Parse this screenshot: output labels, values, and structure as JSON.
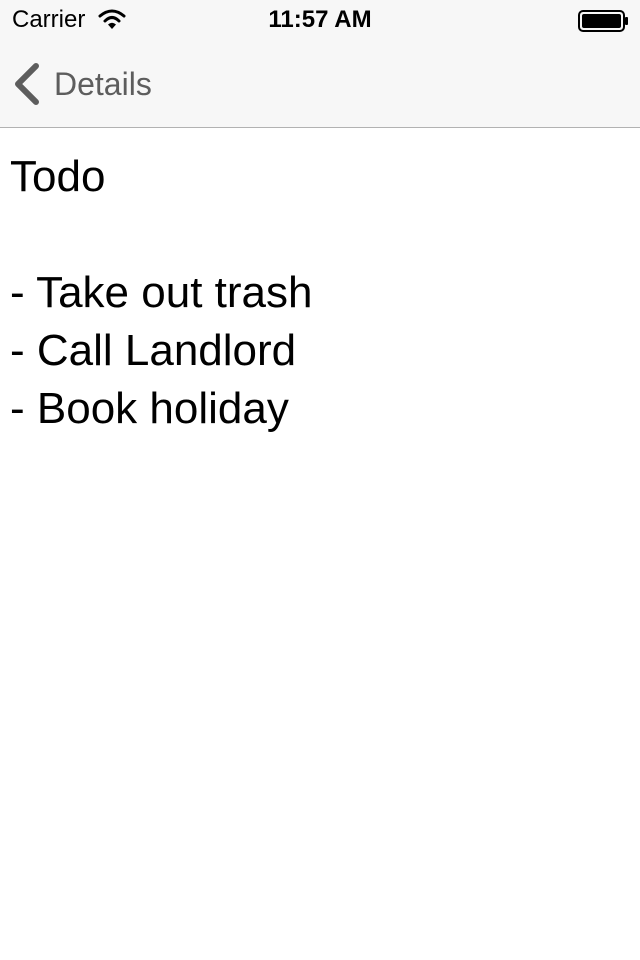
{
  "status_bar": {
    "carrier": "Carrier",
    "time": "11:57 AM",
    "wifi_icon": "wifi-icon",
    "battery_icon": "battery-icon"
  },
  "nav_bar": {
    "back_label": "Details",
    "back_icon": "chevron-left-icon",
    "tint_color": "#5d5d5d"
  },
  "note": {
    "lines": [
      "Todo",
      "",
      "- Take out trash",
      "- Call Landlord",
      "- Book holiday"
    ]
  },
  "colors": {
    "bar_background": "#f7f7f7",
    "separator": "#b2b2b2",
    "content_background": "#ffffff"
  }
}
